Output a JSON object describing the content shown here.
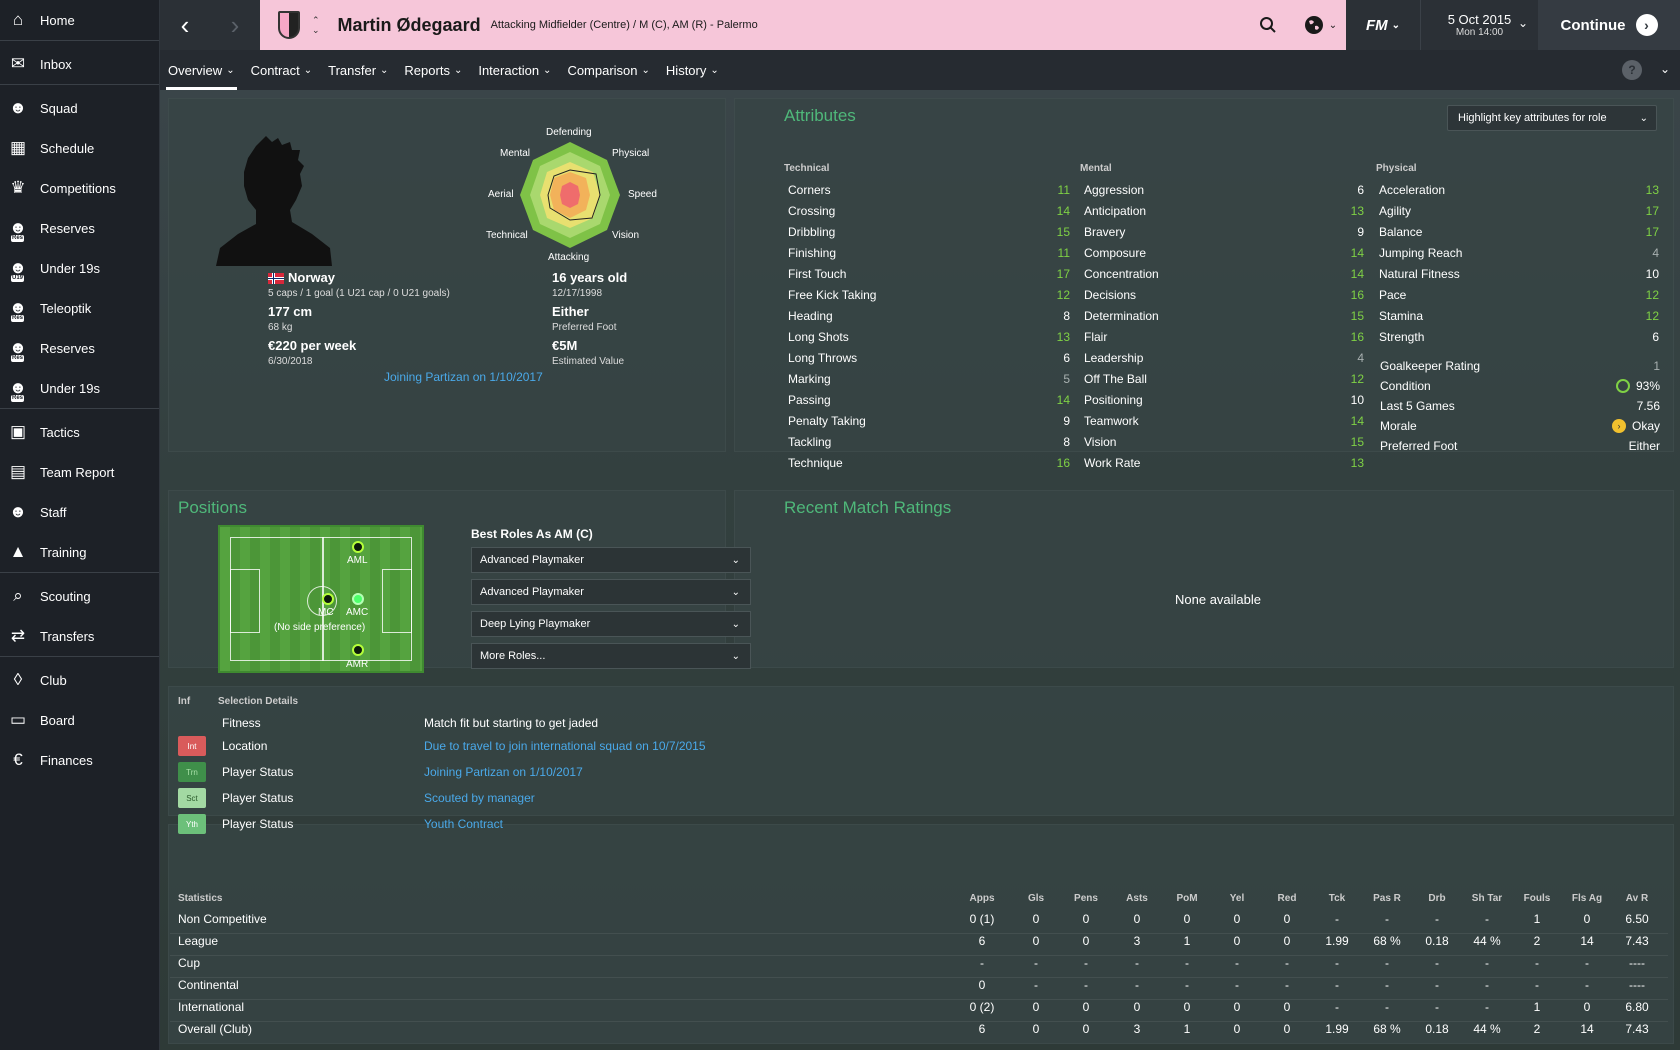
{
  "sidebar": {
    "items": [
      {
        "label": "Home",
        "icon": "home-icon"
      },
      {
        "label": "Inbox",
        "icon": "inbox-icon"
      },
      {
        "label": "Squad",
        "icon": "squad-icon"
      },
      {
        "label": "Schedule",
        "icon": "calendar-icon"
      },
      {
        "label": "Competitions",
        "icon": "trophy-icon"
      },
      {
        "label": "Reserves",
        "icon": "reserves-icon",
        "badge": "Res"
      },
      {
        "label": "Under 19s",
        "icon": "u19-icon",
        "badge": "U19"
      },
      {
        "label": "Teleoptik",
        "icon": "affiliate-icon",
        "badge": "Res"
      },
      {
        "label": "Reserves",
        "icon": "reserves-icon",
        "badge": "Res"
      },
      {
        "label": "Under 19s",
        "icon": "u19-icon",
        "badge": "Res"
      },
      {
        "label": "Tactics",
        "icon": "tactics-icon"
      },
      {
        "label": "Team Report",
        "icon": "report-icon"
      },
      {
        "label": "Staff",
        "icon": "staff-icon"
      },
      {
        "label": "Training",
        "icon": "training-icon"
      },
      {
        "label": "Scouting",
        "icon": "search-icon"
      },
      {
        "label": "Transfers",
        "icon": "transfer-icon"
      },
      {
        "label": "Club",
        "icon": "club-icon"
      },
      {
        "label": "Board",
        "icon": "board-icon"
      },
      {
        "label": "Finances",
        "icon": "euro-icon"
      }
    ]
  },
  "header": {
    "player_name": "Martin Ødegaard",
    "player_position": "Attacking Midfielder (Centre) / M (C), AM (R) - Palermo",
    "fm_label": "FM",
    "date": "5 Oct 2015",
    "time": "Mon 14:00",
    "continue_label": "Continue"
  },
  "tabs": [
    "Overview",
    "Contract",
    "Transfer",
    "Reports",
    "Interaction",
    "Comparison",
    "History"
  ],
  "profile": {
    "nation": "Norway",
    "caps": "5 caps / 1 goal (1 U21 cap / 0 U21 goals)",
    "height": "177 cm",
    "weight": "68 kg",
    "wage": "€220 per week",
    "contract_end": "6/30/2018",
    "age": "16 years old",
    "dob": "12/17/1998",
    "foot": "Either",
    "foot_label": "Preferred Foot",
    "value": "€5M",
    "value_label": "Estimated Value",
    "joining": "Joining Partizan on 1/10/2017",
    "radar_labels": {
      "defending": "Defending",
      "physical": "Physical",
      "speed": "Speed",
      "vision": "Vision",
      "attacking": "Attacking",
      "technical": "Technical",
      "aerial": "Aerial",
      "mental": "Mental"
    }
  },
  "attributes": {
    "title": "Attributes",
    "highlight_label": "Highlight key attributes for role",
    "technical_header": "Technical",
    "mental_header": "Mental",
    "physical_header": "Physical",
    "technical": [
      {
        "name": "Corners",
        "value": "11"
      },
      {
        "name": "Crossing",
        "value": "14"
      },
      {
        "name": "Dribbling",
        "value": "15"
      },
      {
        "name": "Finishing",
        "value": "11"
      },
      {
        "name": "First Touch",
        "value": "17"
      },
      {
        "name": "Free Kick Taking",
        "value": "12"
      },
      {
        "name": "Heading",
        "value": "8"
      },
      {
        "name": "Long Shots",
        "value": "13"
      },
      {
        "name": "Long Throws",
        "value": "6"
      },
      {
        "name": "Marking",
        "value": "5"
      },
      {
        "name": "Passing",
        "value": "14"
      },
      {
        "name": "Penalty Taking",
        "value": "9"
      },
      {
        "name": "Tackling",
        "value": "8"
      },
      {
        "name": "Technique",
        "value": "16"
      }
    ],
    "mental": [
      {
        "name": "Aggression",
        "value": "6"
      },
      {
        "name": "Anticipation",
        "value": "13"
      },
      {
        "name": "Bravery",
        "value": "9"
      },
      {
        "name": "Composure",
        "value": "14"
      },
      {
        "name": "Concentration",
        "value": "14"
      },
      {
        "name": "Decisions",
        "value": "16"
      },
      {
        "name": "Determination",
        "value": "15"
      },
      {
        "name": "Flair",
        "value": "16"
      },
      {
        "name": "Leadership",
        "value": "4"
      },
      {
        "name": "Off The Ball",
        "value": "12"
      },
      {
        "name": "Positioning",
        "value": "10"
      },
      {
        "name": "Teamwork",
        "value": "14"
      },
      {
        "name": "Vision",
        "value": "15"
      },
      {
        "name": "Work Rate",
        "value": "13"
      }
    ],
    "physical": [
      {
        "name": "Acceleration",
        "value": "13"
      },
      {
        "name": "Agility",
        "value": "17"
      },
      {
        "name": "Balance",
        "value": "17"
      },
      {
        "name": "Jumping Reach",
        "value": "4"
      },
      {
        "name": "Natural Fitness",
        "value": "10"
      },
      {
        "name": "Pace",
        "value": "12"
      },
      {
        "name": "Stamina",
        "value": "12"
      },
      {
        "name": "Strength",
        "value": "6"
      }
    ],
    "extra": [
      {
        "name": "Goalkeeper Rating",
        "value": "1"
      },
      {
        "name": "Condition",
        "value": "93%"
      },
      {
        "name": "Last 5 Games",
        "value": "7.56"
      },
      {
        "name": "Morale",
        "value": "Okay"
      },
      {
        "name": "Preferred Foot",
        "value": "Either"
      }
    ]
  },
  "positions": {
    "title": "Positions",
    "best_roles_title": "Best Roles As AM (C)",
    "roles": [
      "Advanced Playmaker",
      "Advanced Playmaker",
      "Deep Lying Playmaker",
      "More Roles..."
    ],
    "pitch_labels": {
      "aml": "AML",
      "mc": "MC",
      "amc": "AMC",
      "note": "(No side preference)",
      "amr": "AMR"
    }
  },
  "recent_ratings": {
    "title": "Recent Match Ratings",
    "empty": "None available"
  },
  "selection": {
    "inf_header": "Inf",
    "details_header": "Selection Details",
    "rows": [
      {
        "tag": "",
        "label": "Fitness",
        "detail": "Match fit but starting to get jaded"
      },
      {
        "tag": "Int",
        "label": "Location",
        "detail": "Due to travel to join international squad on 10/7/2015"
      },
      {
        "tag": "Trn",
        "label": "Player Status",
        "detail": "Joining Partizan on 1/10/2017"
      },
      {
        "tag": "Sct",
        "label": "Player Status",
        "detail": "Scouted by manager"
      },
      {
        "tag": "Yth",
        "label": "Player Status",
        "detail": "Youth Contract"
      }
    ]
  },
  "statistics": {
    "header": "Statistics",
    "columns": [
      "Apps",
      "Gls",
      "Pens",
      "Asts",
      "PoM",
      "Yel",
      "Red",
      "Tck",
      "Pas R",
      "Drb",
      "Sh Tar",
      "Fouls",
      "Fls Ag",
      "Av R"
    ],
    "rows": [
      {
        "label": "Non Competitive",
        "cells": [
          "0 (1)",
          "0",
          "0",
          "0",
          "0",
          "0",
          "0",
          "-",
          "-",
          "-",
          "-",
          "1",
          "0",
          "6.50"
        ]
      },
      {
        "label": "League",
        "cells": [
          "6",
          "0",
          "0",
          "3",
          "1",
          "0",
          "0",
          "1.99",
          "68 %",
          "0.18",
          "44 %",
          "2",
          "14",
          "7.43"
        ]
      },
      {
        "label": "Cup",
        "cells": [
          "-",
          "-",
          "-",
          "-",
          "-",
          "-",
          "-",
          "-",
          "-",
          "-",
          "-",
          "-",
          "-",
          "----"
        ]
      },
      {
        "label": "Continental",
        "cells": [
          "0",
          "-",
          "-",
          "-",
          "-",
          "-",
          "-",
          "-",
          "-",
          "-",
          "-",
          "-",
          "-",
          "----"
        ]
      },
      {
        "label": "International",
        "cells": [
          "0 (2)",
          "0",
          "0",
          "0",
          "0",
          "0",
          "0",
          "-",
          "-",
          "-",
          "-",
          "1",
          "0",
          "6.80"
        ]
      },
      {
        "label": "Overall (Club)",
        "cells": [
          "6",
          "0",
          "0",
          "3",
          "1",
          "0",
          "0",
          "1.99",
          "68 %",
          "0.18",
          "44 %",
          "2",
          "14",
          "7.43"
        ]
      }
    ]
  }
}
